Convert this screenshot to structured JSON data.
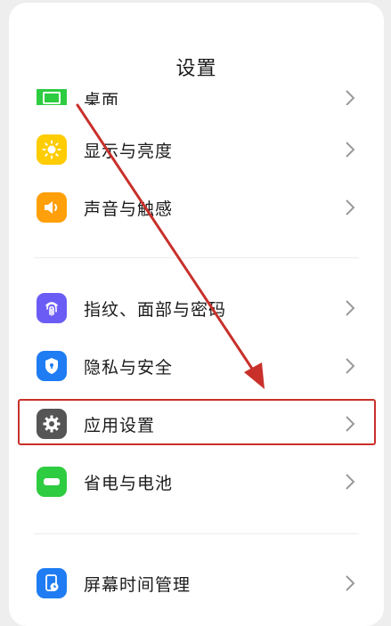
{
  "header": {
    "title": "设置"
  },
  "items": [
    {
      "label": "桌面",
      "icon": "desktop-icon",
      "color": "#2ecc40"
    },
    {
      "label": "显示与亮度",
      "icon": "sun-icon",
      "color": "#ffcc00"
    },
    {
      "label": "声音与触感",
      "icon": "speaker-icon",
      "color": "#ff9f0a"
    },
    {
      "label": "指纹、面部与密码",
      "icon": "fingerprint-icon",
      "color": "#6b5cf5"
    },
    {
      "label": "隐私与安全",
      "icon": "shield-icon",
      "color": "#1f7cf2"
    },
    {
      "label": "应用设置",
      "icon": "gear-icon",
      "color": "#555555"
    },
    {
      "label": "省电与电池",
      "icon": "battery-icon",
      "color": "#2ecc40"
    },
    {
      "label": "屏幕时间管理",
      "icon": "screen-time-icon",
      "color": "#1f7cf2"
    }
  ],
  "annotation": {
    "highlight_color": "#c9302a",
    "arrow_color": "#c9302a"
  }
}
